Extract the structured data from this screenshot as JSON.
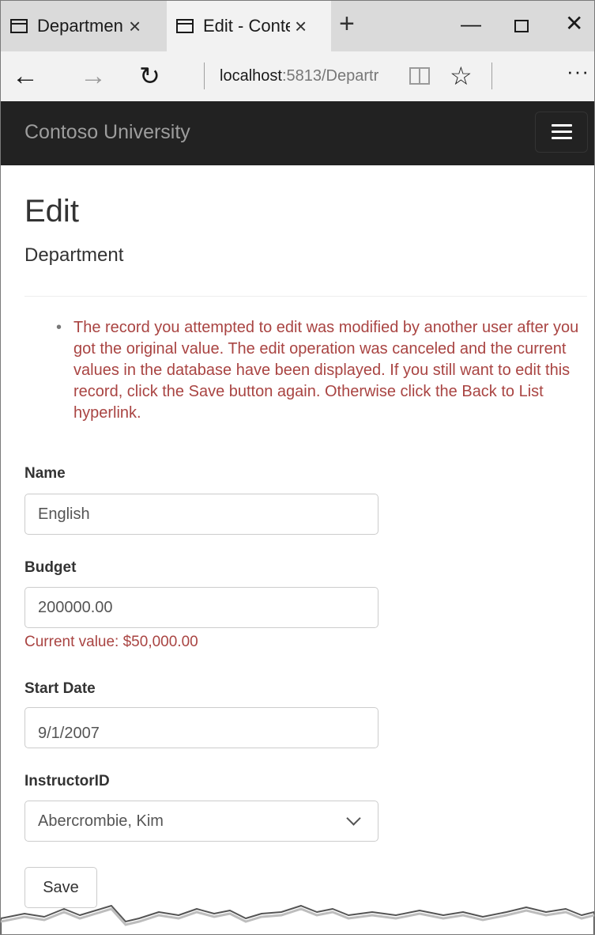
{
  "browser": {
    "tabs": [
      {
        "title": "Departmen"
      },
      {
        "title": "Edit - Conte"
      }
    ],
    "tab_close_glyph": "×",
    "new_tab_glyph": "+",
    "address": {
      "host": "localhost",
      "rest": ":5813/Departr"
    }
  },
  "navbar": {
    "brand": "Contoso University"
  },
  "page": {
    "title": "Edit",
    "subtitle": "Department",
    "validation_summary": [
      "The record you attempted to edit was modified by another user after you got the original value. The edit operation was canceled and the current values in the database have been displayed. If you still want to edit this record, click the Save button again. Otherwise click the Back to List hyperlink."
    ],
    "fields": {
      "name": {
        "label": "Name",
        "value": "English"
      },
      "budget": {
        "label": "Budget",
        "value": "200000.00",
        "error": "Current value: $50,000.00"
      },
      "start_date": {
        "label": "Start Date",
        "value": "9/1/2007"
      },
      "instructor": {
        "label": "InstructorID",
        "value": "Abercrombie, Kim"
      }
    },
    "save_label": "Save"
  },
  "colors": {
    "navbar_bg": "#222222",
    "brand": "#9d9d9d",
    "error": "#a94442",
    "tabbar_bg": "#dadada",
    "active_tab_bg": "#f2f2f2"
  },
  "icons": {
    "tab_icon": "tab-page-icon",
    "back": "back-arrow-icon",
    "forward": "forward-arrow-icon",
    "refresh": "refresh-icon",
    "reading_view": "reading-view-icon",
    "favorite": "star-icon",
    "more": "more-icon",
    "menu": "hamburger-icon",
    "select": "chevron-down-icon"
  }
}
